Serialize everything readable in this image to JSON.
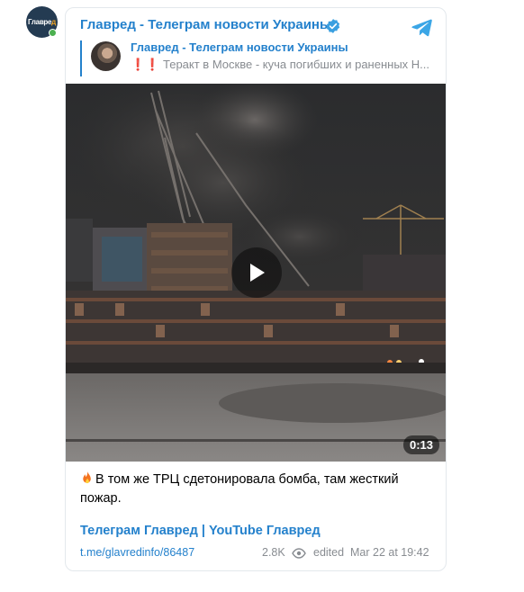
{
  "channel": {
    "avatar_text_main": "Главре",
    "avatar_text_accent": "д",
    "title": "Главред - Телеграм новости Украины"
  },
  "reply": {
    "author": "Главред - Телеграм новости Украины",
    "marks": "❗❗",
    "text": "Теракт в Москве - куча погибших и раненных Н..."
  },
  "video": {
    "duration": "0:13"
  },
  "message": {
    "text": "В том же ТРЦ сдетонировала бомба, там жесткий пожар."
  },
  "links": {
    "telegram": "Телеграм Главред",
    "separator": "|",
    "youtube": "YouTube Главред"
  },
  "footer": {
    "post_link": "t.me/glavredinfo/86487",
    "views": "2.8K",
    "edited": "edited",
    "date": "Mar 22 at 19:42"
  },
  "colors": {
    "accent": "#2481cc",
    "muted": "#888c91",
    "alert": "#e0291f"
  },
  "icons": [
    "verified-icon",
    "telegram-icon",
    "play-icon",
    "fire-icon",
    "eye-icon"
  ]
}
